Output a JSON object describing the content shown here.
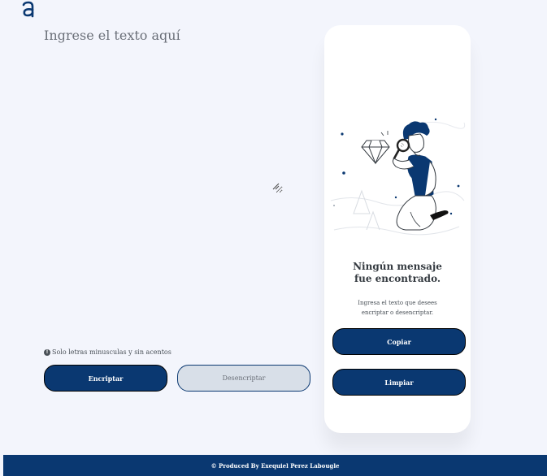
{
  "app": {
    "logo_icon": "alura-logo",
    "logo_letter": "a"
  },
  "input": {
    "placeholder": "Ingrese el texto aquí",
    "value": ""
  },
  "hint": {
    "icon": "info-icon",
    "icon_glyph": "!",
    "text": "Solo letras minusculas y sin acentos"
  },
  "buttons": {
    "encrypt_label": "Encriptar",
    "decrypt_label": "Desencriptar",
    "copy_label": "Copiar",
    "clear_label": "Limpiar"
  },
  "output": {
    "illustration": "person-with-magnifying-glass-illustration",
    "title": "Ningún mensaje fue encontrado.",
    "text": "Ingresa el texto que desees encriptar o desencriptar."
  },
  "footer": {
    "text": "© Produced By Exequiel Perez Labougle"
  },
  "colors": {
    "background": "#f3f5fc",
    "primary": "#0a3871",
    "secondary": "#d8dfe8",
    "card": "#ffffff"
  }
}
